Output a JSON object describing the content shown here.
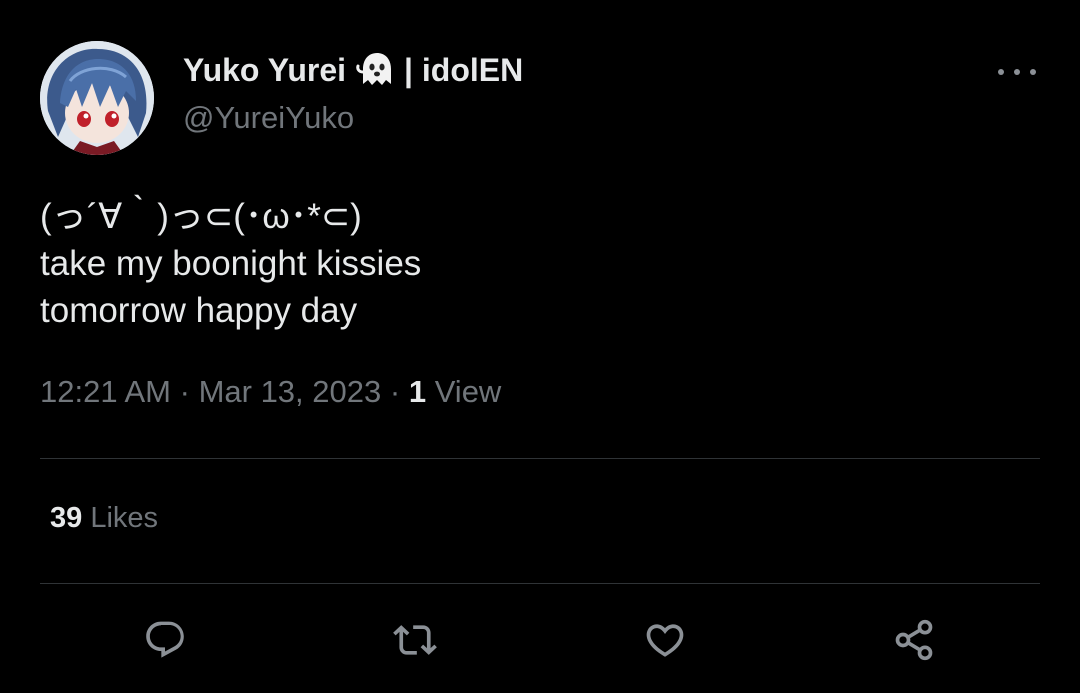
{
  "author": {
    "display_name": "Yuko Yurei",
    "name_suffix": "| idolEN",
    "handle": "@YureiYuko",
    "emoji_icon": "ghost-icon",
    "avatar_icon": "avatar-image"
  },
  "tweet": {
    "lines": [
      "(っ´∀｀)っ⊂(･ω･*⊂)",
      "take my boonight kissies",
      "tomorrow happy day"
    ]
  },
  "meta": {
    "time": "12:21 AM",
    "date": "Mar 13, 2023",
    "separator": "·",
    "views_count": "1",
    "views_label": "View"
  },
  "stats": {
    "likes_count": "39",
    "likes_label": "Likes"
  },
  "actions": [
    {
      "name": "reply",
      "icon": "reply-icon"
    },
    {
      "name": "retweet",
      "icon": "retweet-icon"
    },
    {
      "name": "like",
      "icon": "heart-icon"
    },
    {
      "name": "share",
      "icon": "share-icon"
    }
  ],
  "colors": {
    "background": "#000000",
    "text": "#e7e9ea",
    "secondary": "#71767b",
    "divider": "#2f3336"
  }
}
